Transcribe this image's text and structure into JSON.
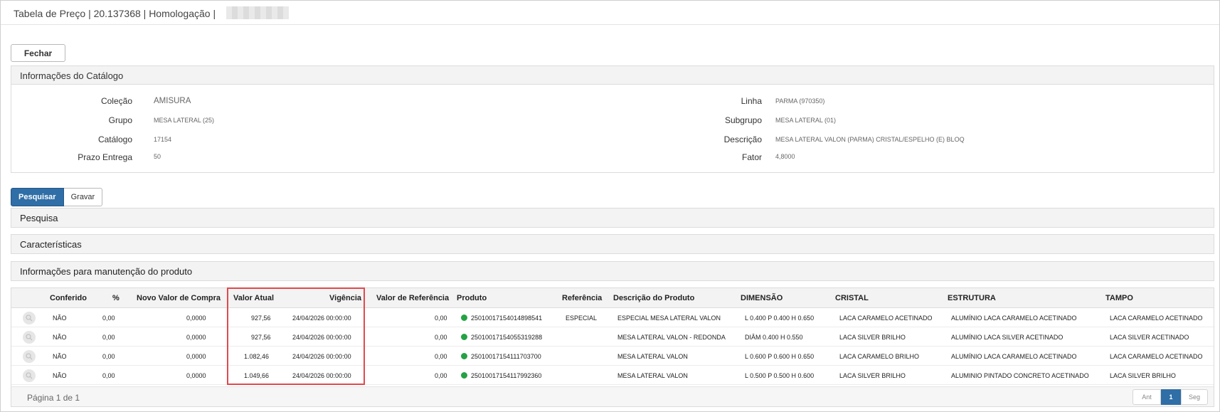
{
  "window": {
    "title": "Tabela de Preço | 20.137368 | Homologação |"
  },
  "toolbar": {
    "close_label": "Fechar"
  },
  "catalog": {
    "header": "Informações do Catálogo",
    "left": [
      {
        "label": "Coleção",
        "value": "AMISURA"
      },
      {
        "label": "Grupo",
        "value": "MESA LATERAL (25)"
      },
      {
        "label": "Catálogo",
        "value": "17154"
      },
      {
        "label": "Prazo Entrega",
        "value": "50"
      }
    ],
    "right": [
      {
        "label": "Linha",
        "value": "PARMA (970350)"
      },
      {
        "label": "Subgrupo",
        "value": "MESA LATERAL (01)"
      },
      {
        "label": "Descrição",
        "value": "MESA LATERAL VALON (PARMA) CRISTAL/ESPELHO (E) BLOQ"
      },
      {
        "label": "Fator",
        "value": "4,8000"
      }
    ]
  },
  "actions": {
    "search_label": "Pesquisar",
    "save_label": "Gravar"
  },
  "sections": {
    "search": "Pesquisa",
    "characteristics": "Características",
    "maintenance": "Informações para manutenção do produto"
  },
  "table": {
    "columns": {
      "conferido": "Conferido",
      "percent": "%",
      "novo_valor": "Novo Valor de Compra",
      "valor_atual": "Valor Atual",
      "vigencia": "Vigência",
      "valor_referencia": "Valor de Referência",
      "produto": "Produto",
      "referencia": "Referência",
      "descricao": "Descrição do Produto",
      "dimensao": "DIMENSÃO",
      "cristal": "CRISTAL",
      "estrutura": "ESTRUTURA",
      "tampo": "TAMPO"
    },
    "rows": [
      {
        "conferido": "NÃO",
        "percent": "0,00",
        "novo_valor": "0,0000",
        "valor_atual": "927,56",
        "vigencia": "24/04/2026 00:00:00",
        "valor_referencia": "0,00",
        "produto": "25010017154014898541",
        "referencia": "ESPECIAL",
        "descricao": "ESPECIAL MESA LATERAL VALON",
        "dimensao": "L 0.400 P 0.400 H 0.650",
        "cristal": "LACA CARAMELO ACETINADO",
        "estrutura": "ALUMÍNIO LACA CARAMELO ACETINADO",
        "tampo": "LACA CARAMELO ACETINADO"
      },
      {
        "conferido": "NÃO",
        "percent": "0,00",
        "novo_valor": "0,0000",
        "valor_atual": "927,56",
        "vigencia": "24/04/2026 00:00:00",
        "valor_referencia": "0,00",
        "produto": "25010017154055319288",
        "referencia": "",
        "descricao": "MESA LATERAL VALON - REDONDA",
        "dimensao": "DIÂM 0.400 H 0.550",
        "cristal": "LACA SILVER BRILHO",
        "estrutura": "ALUMÍNIO LACA SILVER ACETINADO",
        "tampo": "LACA SILVER ACETINADO"
      },
      {
        "conferido": "NÃO",
        "percent": "0,00",
        "novo_valor": "0,0000",
        "valor_atual": "1.082,46",
        "vigencia": "24/04/2026 00:00:00",
        "valor_referencia": "0,00",
        "produto": "25010017154111703700",
        "referencia": "",
        "descricao": "MESA LATERAL VALON",
        "dimensao": "L 0.600 P 0.600 H 0.650",
        "cristal": "LACA CARAMELO BRILHO",
        "estrutura": "ALUMÍNIO LACA CARAMELO ACETINADO",
        "tampo": "LACA CARAMELO ACETINADO"
      },
      {
        "conferido": "NÃO",
        "percent": "0,00",
        "novo_valor": "0,0000",
        "valor_atual": "1.049,66",
        "vigencia": "24/04/2026 00:00:00",
        "valor_referencia": "0,00",
        "produto": "25010017154117992360",
        "referencia": "",
        "descricao": "MESA LATERAL VALON",
        "dimensao": "L 0.500 P 0.500 H 0.600",
        "cristal": "LACA SILVER BRILHO",
        "estrutura": "ALUMINIO PINTADO CONCRETO ACETINADO",
        "tampo": "LACA SILVER BRILHO"
      }
    ]
  },
  "pagination": {
    "info": "Página 1 de 1",
    "prev": "Ant",
    "current": "1",
    "next": "Seg"
  }
}
